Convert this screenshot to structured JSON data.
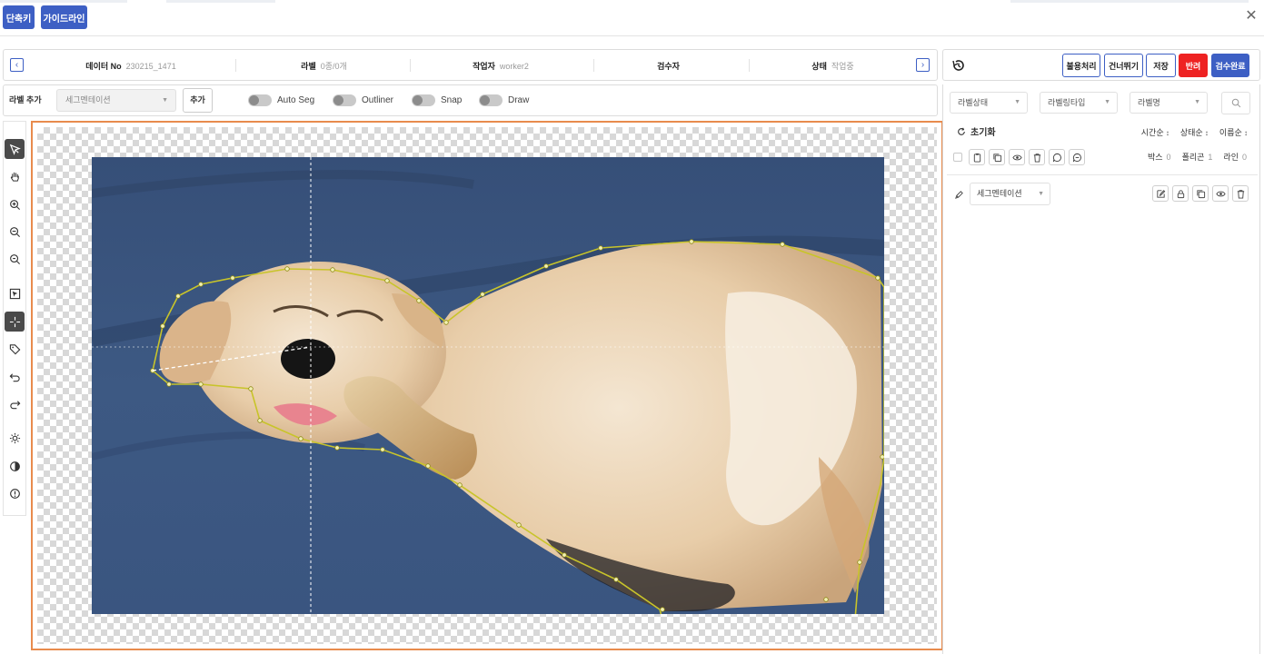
{
  "topbar": {
    "shortcut_label": "단축키",
    "guideline_label": "가이드라인"
  },
  "info": {
    "data_no_label": "데이터 No",
    "data_no_value": "230215_1471",
    "label_label": "라벨",
    "label_value": "0종/0개",
    "worker_label": "작업자",
    "worker_value": "worker2",
    "inspector_label": "검수자",
    "inspector_value": "",
    "status_label": "상태",
    "status_value": "작업중"
  },
  "label_add": {
    "title": "라벨 추가",
    "select_value": "세그멘테이션",
    "add_label": "추가",
    "toggles": [
      "Auto Seg",
      "Outliner",
      "Snap",
      "Draw"
    ]
  },
  "header_actions": {
    "defect_label": "불용처리",
    "skip_label": "건너뛰기",
    "save_label": "저장",
    "reject_label": "반려",
    "complete_label": "검수완료"
  },
  "filters": {
    "label_status": "라벨상태",
    "labeling_type": "라벨링타입",
    "label_name": "라벨명"
  },
  "list": {
    "reset_label": "초기화",
    "sort_time": "시간순",
    "sort_status": "상태순",
    "sort_name": "이름순",
    "box_label": "박스",
    "box_count": "0",
    "polygon_label": "폴리곤",
    "polygon_count": "1",
    "line_label": "라인",
    "line_count": "0"
  },
  "label_row": {
    "type_value": "세그멘테이션"
  },
  "colors": {
    "accent": "#3d5fc4",
    "reject": "#ee2222",
    "canvas_border": "#e88b4d",
    "polygon": "#c8c42a"
  },
  "tools": [
    "select-icon",
    "hand-icon",
    "zoom-in-icon",
    "zoom-out-icon",
    "zoom-fit-icon",
    "select-area-icon",
    "crosshair-icon",
    "tag-icon",
    "undo-icon",
    "redo-icon",
    "brightness-icon",
    "contrast-icon",
    "info-icon"
  ]
}
